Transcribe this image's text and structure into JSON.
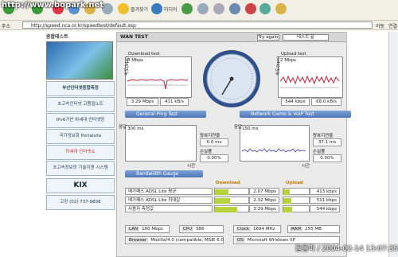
{
  "watermark_url": "http://www.bopark.net",
  "toolbar": {
    "favorites_label": "즐겨찾기",
    "media_label": "미디어"
  },
  "address": {
    "label": "주소",
    "url": "http://speed.nca.or.kr/speedtest/default.asp",
    "go_label": "이동",
    "links_label": "연결"
  },
  "sidebar": {
    "title": "종합테스트",
    "items": [
      {
        "label": "부산인터넷종합측정"
      },
      {
        "label": "초고속인터넷 고품질노트"
      },
      {
        "label": "IPv6기반 차세대 인터넷망"
      },
      {
        "label": "국가정보화 Portalsite"
      },
      {
        "label": "하세대 인터넷쇼"
      },
      {
        "label": "초고속정보망 기술지원 시스템"
      },
      {
        "label": "KIX"
      },
      {
        "label": "고장 (02) 737-9898"
      }
    ]
  },
  "panel": {
    "title": "WAN TEST",
    "try_again": "Try again",
    "test_name": "테스트 끝",
    "download": {
      "title": "Download test",
      "ymax": "8 Mbps",
      "axis": "속도(bps)",
      "time_label": "시간",
      "rate": "3.29 Mbps",
      "bytes": "411 kB/s"
    },
    "upload": {
      "title": "Upload test",
      "ymax": "2 Mbps",
      "axis": "속도(bps)",
      "time_label": "시간",
      "rate": "544 kbps",
      "bytes": "68.0 kB/s"
    },
    "ping_title": "General Ping Test",
    "voip_title": "Network Game & VoIP Test",
    "ping": {
      "ymax": "300 ms",
      "axis": "응답",
      "time_label": "시간",
      "rtt_label": "왕복지연율",
      "rtt": "0.0 ms",
      "loss_label": "손실률",
      "loss": "0.00%"
    },
    "voip": {
      "ymax": "150 ms",
      "axis": "응답",
      "time_label": "시간",
      "rtt_label": "왕복지연율",
      "rtt": "37.1 ms",
      "loss_label": "손실률",
      "loss": "0.00%"
    },
    "bw_title": "Bandwidth Gauge",
    "bw_download_label": "Download",
    "bw_upload_label": "Upload",
    "bw_rows": [
      {
        "label": "메가패스 ADSL Lite 평균",
        "down": "2.07 Mbps",
        "down_frac": 0.41,
        "up": "413 kbps",
        "up_frac": 0.25
      },
      {
        "label": "메가패스 ADSL Lite 최대값",
        "down": "2.32 Mbps",
        "down_frac": 0.46,
        "up": "511 kbps",
        "up_frac": 0.31
      },
      {
        "label": "사용자 측정값",
        "down": "3.29 Mbps",
        "down_frac": 0.66,
        "up": "544 kbps",
        "up_frac": 0.33
      }
    ],
    "sys": {
      "lan_label": "LAN",
      "lan": "100 Mbps",
      "cpu_label": "CPU",
      "cpu": "586",
      "clock_label": "Clock",
      "clock": "1694 MHz",
      "ram_label": "RAM",
      "ram": "255 MB",
      "browser_label": "Browser",
      "browser": "Mozilla/4.0 (compatible; MSIE 6.0",
      "os_label": "OS",
      "os": "Microsoft Windows XP"
    }
  },
  "footer_watermark": "돌돌이 / 2004-02-14 13:07:35"
}
